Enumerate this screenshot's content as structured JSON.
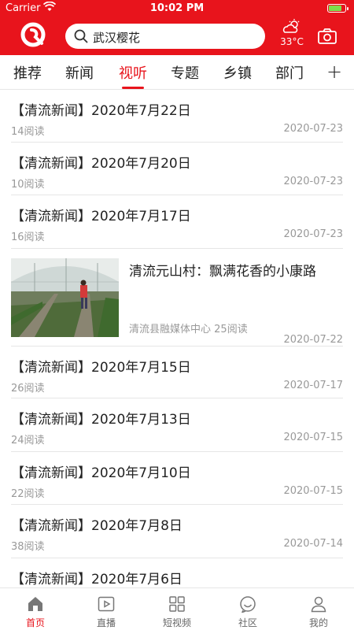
{
  "status_bar": {
    "carrier": "Carrier",
    "time": "10:02 PM"
  },
  "header": {
    "search_text": "武汉樱花",
    "temperature": "33°C"
  },
  "tabs": [
    {
      "label": "推荐"
    },
    {
      "label": "新闻"
    },
    {
      "label": "视听"
    },
    {
      "label": "专题"
    },
    {
      "label": "乡镇"
    },
    {
      "label": "部门"
    }
  ],
  "tabs_more": "+",
  "active_tab": "视听",
  "news": [
    {
      "title": "【清流新闻】2020年7月22日",
      "reads": "14阅读",
      "date": "2020-07-23"
    },
    {
      "title": "【清流新闻】2020年7月20日",
      "reads": "10阅读",
      "date": "2020-07-23"
    },
    {
      "title": "【清流新闻】2020年7月17日",
      "reads": "16阅读",
      "date": "2020-07-23"
    },
    {
      "title": "【清流新闻】2020年7月15日",
      "reads": "26阅读",
      "date": "2020-07-17"
    },
    {
      "title": "【清流新闻】2020年7月13日",
      "reads": "24阅读",
      "date": "2020-07-15"
    },
    {
      "title": "【清流新闻】2020年7月10日",
      "reads": "22阅读",
      "date": "2020-07-15"
    },
    {
      "title": "【清流新闻】2020年7月8日",
      "reads": "38阅读",
      "date": "2020-07-14"
    },
    {
      "title": "【清流新闻】2020年7月6日",
      "reads": "",
      "date": ""
    }
  ],
  "featured": {
    "title": "清流元山村：飘满花香的小康路",
    "source": "清流县融媒体中心",
    "reads": "25阅读",
    "date": "2020-07-22"
  },
  "bottom_nav": [
    {
      "label": "首页",
      "icon": "home-icon"
    },
    {
      "label": "直播",
      "icon": "live-icon"
    },
    {
      "label": "短视频",
      "icon": "short-video-icon"
    },
    {
      "label": "社区",
      "icon": "community-icon"
    },
    {
      "label": "我的",
      "icon": "profile-icon"
    }
  ],
  "colors": {
    "brand_red": "#e8141c",
    "muted_text": "#999999",
    "divider": "#e6e6e6"
  }
}
